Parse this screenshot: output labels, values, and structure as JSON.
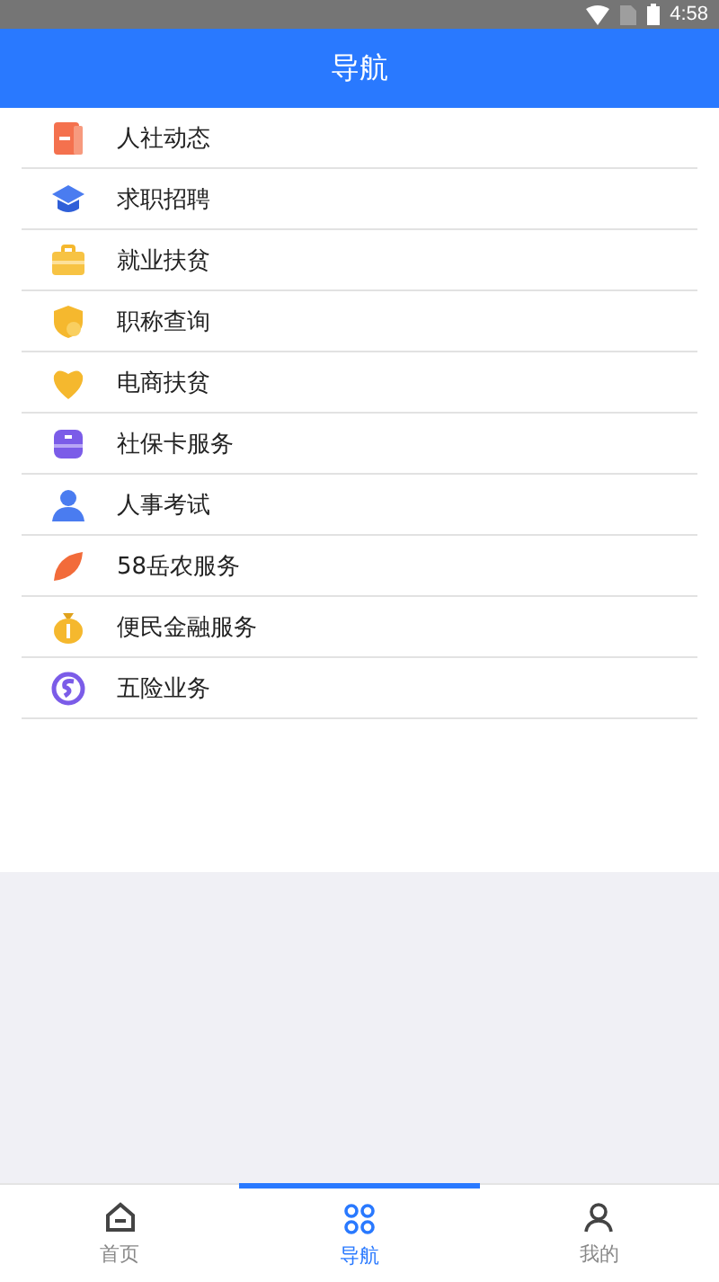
{
  "status_bar": {
    "time": "4:58"
  },
  "header": {
    "title": "导航"
  },
  "menu": [
    {
      "label": "人社动态"
    },
    {
      "label": "求职招聘"
    },
    {
      "label": "就业扶贫"
    },
    {
      "label": "职称查询"
    },
    {
      "label": "电商扶贫"
    },
    {
      "label": "社保卡服务"
    },
    {
      "label": "人事考试"
    },
    {
      "label": "58岳农服务"
    },
    {
      "label": "便民金融服务"
    },
    {
      "label": "五险业务"
    }
  ],
  "tabs": [
    {
      "label": "首页",
      "selected": false
    },
    {
      "label": "导航",
      "selected": true
    },
    {
      "label": "我的",
      "selected": false
    }
  ]
}
